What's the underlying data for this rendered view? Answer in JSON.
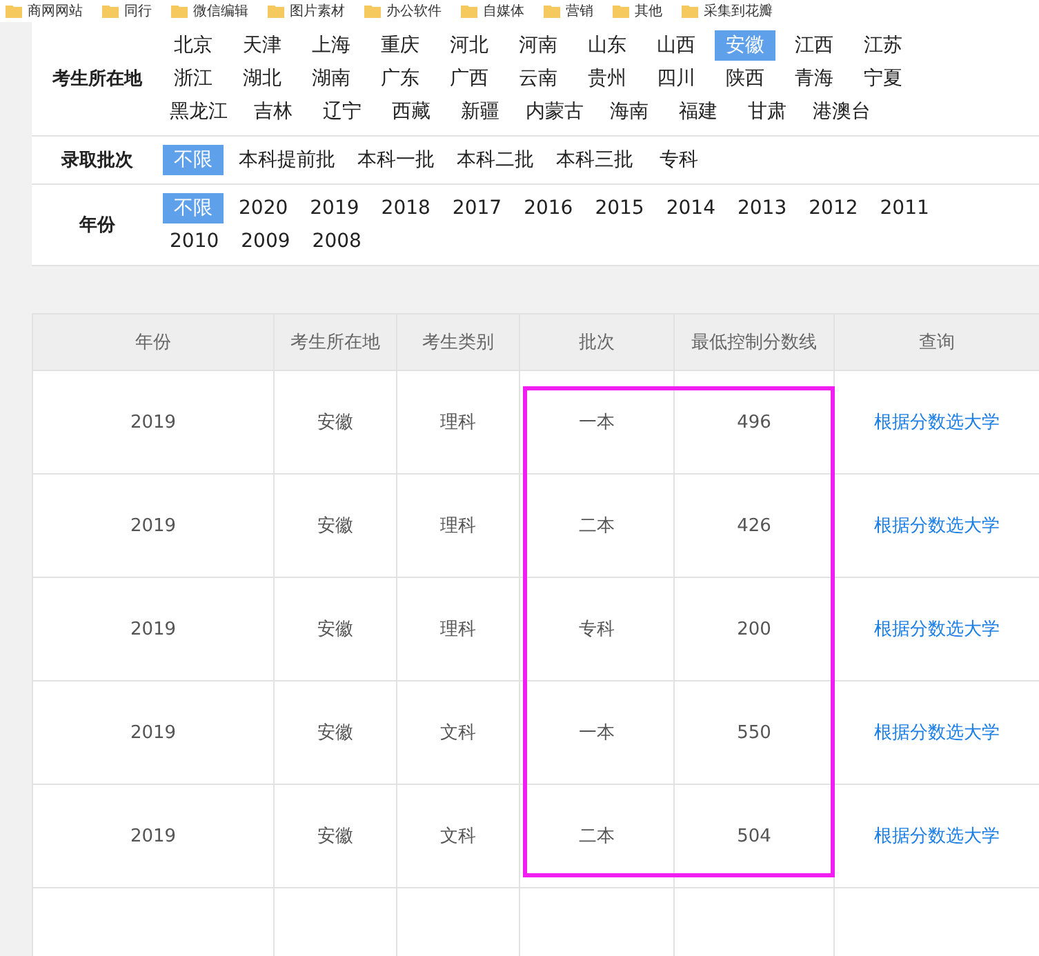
{
  "bookmarks": [
    "商网网站",
    "同行",
    "微信编辑",
    "图片素材",
    "办公软件",
    "自媒体",
    "营销",
    "其他",
    "采集到花瓣"
  ],
  "filters": [
    {
      "label": "考生所在地",
      "options": [
        {
          "label": "北京",
          "selected": false
        },
        {
          "label": "天津",
          "selected": false
        },
        {
          "label": "上海",
          "selected": false
        },
        {
          "label": "重庆",
          "selected": false
        },
        {
          "label": "河北",
          "selected": false
        },
        {
          "label": "河南",
          "selected": false
        },
        {
          "label": "山东",
          "selected": false
        },
        {
          "label": "山西",
          "selected": false
        },
        {
          "label": "安徽",
          "selected": true
        },
        {
          "label": "江西",
          "selected": false
        },
        {
          "label": "江苏",
          "selected": false
        },
        {
          "label": "浙江",
          "selected": false
        },
        {
          "label": "湖北",
          "selected": false
        },
        {
          "label": "湖南",
          "selected": false
        },
        {
          "label": "广东",
          "selected": false
        },
        {
          "label": "广西",
          "selected": false
        },
        {
          "label": "云南",
          "selected": false
        },
        {
          "label": "贵州",
          "selected": false
        },
        {
          "label": "四川",
          "selected": false
        },
        {
          "label": "陕西",
          "selected": false
        },
        {
          "label": "青海",
          "selected": false
        },
        {
          "label": "宁夏",
          "selected": false
        },
        {
          "label": "黑龙江",
          "selected": false
        },
        {
          "label": "吉林",
          "selected": false
        },
        {
          "label": "辽宁",
          "selected": false
        },
        {
          "label": "西藏",
          "selected": false
        },
        {
          "label": "新疆",
          "selected": false
        },
        {
          "label": "内蒙古",
          "selected": false
        },
        {
          "label": "海南",
          "selected": false
        },
        {
          "label": "福建",
          "selected": false
        },
        {
          "label": "甘肃",
          "selected": false
        },
        {
          "label": "港澳台",
          "selected": false
        }
      ]
    },
    {
      "label": "录取批次",
      "options": [
        {
          "label": "不限",
          "selected": true
        },
        {
          "label": "本科提前批",
          "selected": false
        },
        {
          "label": "本科一批",
          "selected": false
        },
        {
          "label": "本科二批",
          "selected": false
        },
        {
          "label": "本科三批",
          "selected": false
        },
        {
          "label": "专科",
          "selected": false
        }
      ]
    },
    {
      "label": "年份",
      "options": [
        {
          "label": "不限",
          "selected": true
        },
        {
          "label": "2020",
          "selected": false
        },
        {
          "label": "2019",
          "selected": false
        },
        {
          "label": "2018",
          "selected": false
        },
        {
          "label": "2017",
          "selected": false
        },
        {
          "label": "2016",
          "selected": false
        },
        {
          "label": "2015",
          "selected": false
        },
        {
          "label": "2014",
          "selected": false
        },
        {
          "label": "2013",
          "selected": false
        },
        {
          "label": "2012",
          "selected": false
        },
        {
          "label": "2011",
          "selected": false
        },
        {
          "label": "2010",
          "selected": false
        },
        {
          "label": "2009",
          "selected": false
        },
        {
          "label": "2008",
          "selected": false
        }
      ]
    }
  ],
  "table": {
    "columns": [
      "年份",
      "考生所在地",
      "考生类别",
      "批次",
      "最低控制分数线",
      "查询"
    ],
    "rows": [
      [
        "2019",
        "安徽",
        "理科",
        "一本",
        "496",
        "根据分数选大学"
      ],
      [
        "2019",
        "安徽",
        "理科",
        "二本",
        "426",
        "根据分数选大学"
      ],
      [
        "2019",
        "安徽",
        "理科",
        "专科",
        "200",
        "根据分数选大学"
      ],
      [
        "2019",
        "安徽",
        "文科",
        "一本",
        "550",
        "根据分数选大学"
      ],
      [
        "2019",
        "安徽",
        "文科",
        "二本",
        "504",
        "根据分数选大学"
      ]
    ]
  }
}
